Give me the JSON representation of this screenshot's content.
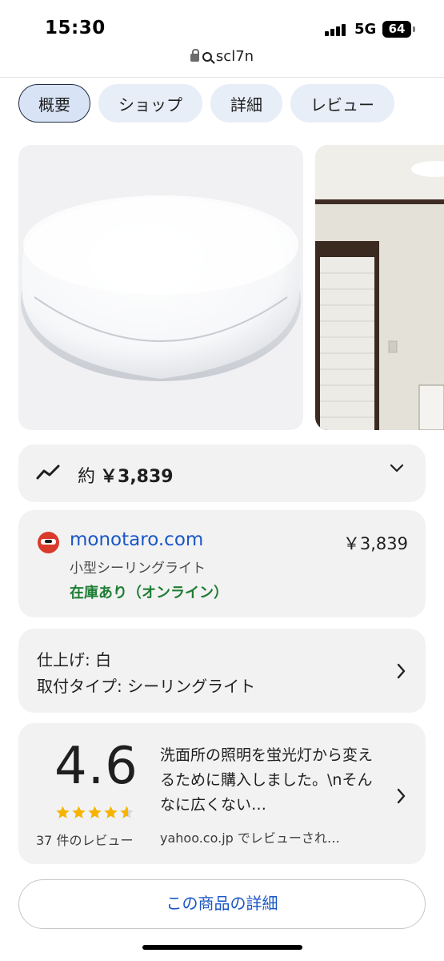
{
  "status_bar": {
    "time": "15:30",
    "network": "5G",
    "battery": "64"
  },
  "url_bar": {
    "text": "scl7n"
  },
  "tabs": [
    {
      "label": "概要",
      "active": true
    },
    {
      "label": "ショップ",
      "active": false
    },
    {
      "label": "詳細",
      "active": false
    },
    {
      "label": "レビュー",
      "active": false
    }
  ],
  "price_summary": {
    "prefix": "約",
    "price": "￥3,839"
  },
  "seller": {
    "name": "monotaro.com",
    "price": "￥3,839",
    "description": "小型シーリングライト",
    "stock": "在庫あり（オンライン）"
  },
  "specs": {
    "line1": "仕上げ: 白",
    "line2": "取付タイプ: シーリングライト"
  },
  "review": {
    "rating": "4.6",
    "stars": 4.6,
    "count_label": "37 件のレビュー",
    "text": "洗面所の照明を蛍光灯から変えるために購入しました。\\nそんなに広くない…",
    "source": "yahoo.co.jp でレビューされ…"
  },
  "details_button": {
    "label": "この商品の詳細"
  },
  "colors": {
    "link_blue": "#1a56c6",
    "stock_green": "#1e7d34",
    "chip_bg": "#e8eef8",
    "card_bg": "#f2f2f2",
    "star": "#f5b400"
  }
}
